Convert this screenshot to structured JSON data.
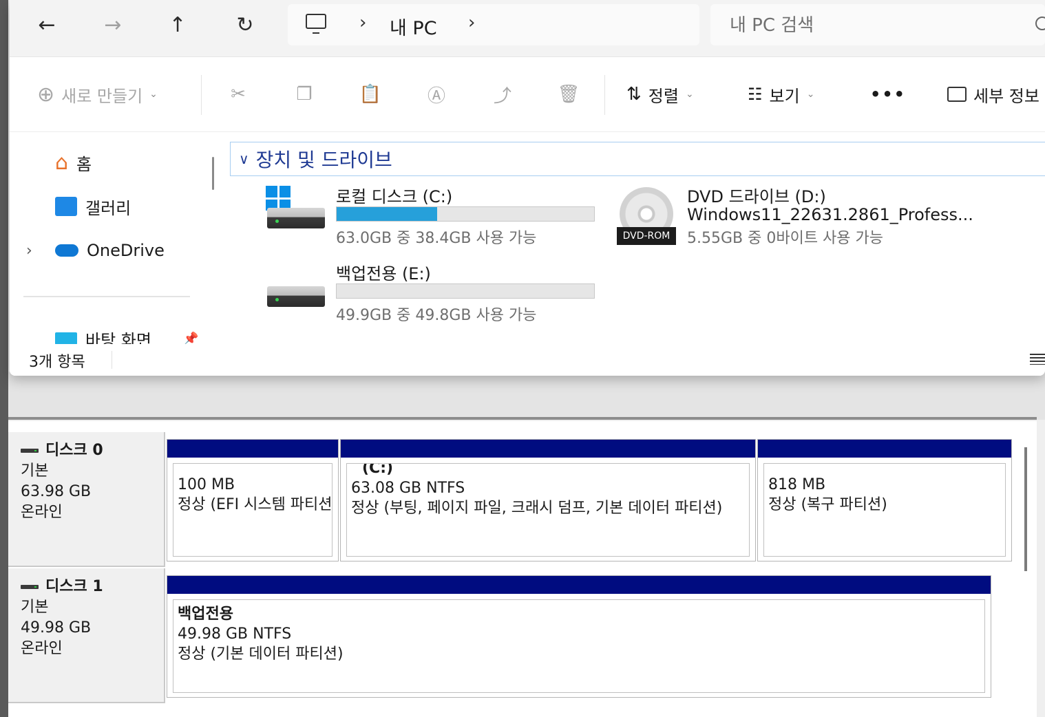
{
  "explorer": {
    "nav": {
      "back_icon": "arrow-left-icon",
      "forward_icon": "arrow-right-icon",
      "up_icon": "arrow-up-icon",
      "refresh_icon": "refresh-icon"
    },
    "address": {
      "crumb": "내 PC"
    },
    "search": {
      "placeholder": "내 PC 검색"
    },
    "toolbar": {
      "new_label": "새로 만들기",
      "sort_label": "정렬",
      "view_label": "보기",
      "more_label": "•••",
      "details_label": "세부 정보"
    },
    "sidebar": {
      "home": "홈",
      "gallery": "갤러리",
      "onedrive": "OneDrive",
      "desktop": "바탕 화면"
    },
    "group_header": "장치 및 드라이브",
    "drives": [
      {
        "title": "로컬 디스크 (C:)",
        "sub": "63.0GB 중 38.4GB 사용 가능",
        "used_fraction": 0.39
      },
      {
        "title": "백업전용 (E:)",
        "sub": "49.9GB 중 49.8GB 사용 가능",
        "used_fraction": 0.0
      },
      {
        "title": "DVD 드라이브 (D:)",
        "label": "Windows11_22631.2861_Profess...",
        "sub": "5.55GB 중 0바이트 사용 가능",
        "badge": "DVD-ROM"
      }
    ],
    "status": {
      "count": "3개 항목"
    }
  },
  "disk_mgmt": {
    "disks": [
      {
        "name": "디스크 0",
        "type": "기본",
        "size": "63.98 GB",
        "state": "온라인",
        "partitions": [
          {
            "title": "",
            "size": "100 MB",
            "status": "정상 (EFI 시스템 파티션)"
          },
          {
            "title": "(C:)",
            "size": "63.08 GB NTFS",
            "status": "정상 (부팅, 페이지 파일, 크래시 덤프, 기본 데이터 파티션)"
          },
          {
            "title": "",
            "size": "818 MB",
            "status": "정상 (복구 파티션)"
          }
        ]
      },
      {
        "name": "디스크 1",
        "type": "기본",
        "size": "49.98 GB",
        "state": "온라인",
        "partitions": [
          {
            "title": "백업전용",
            "size": "49.98 GB NTFS",
            "status": "정상 (기본 데이터 파티션)"
          }
        ]
      }
    ]
  },
  "colors": {
    "partition_bar": "#000c80",
    "usage_fill": "#26a0da",
    "group_header_text": "#1f3a93"
  }
}
